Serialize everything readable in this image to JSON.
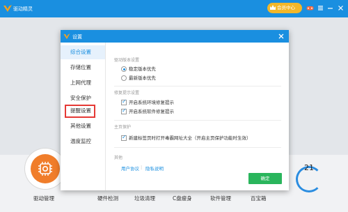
{
  "app": {
    "title": "驱动精灵",
    "vip_label": "会员中心"
  },
  "bottom_nav": [
    "驱动管理",
    "硬件检测",
    "垃圾清理",
    "C盘瘦身",
    "软件管理",
    "百宝箱"
  ],
  "score": "21",
  "dialog": {
    "title": "设置",
    "nav": [
      "综合设置",
      "存储位置",
      "上网代理",
      "安全保护",
      "提醒设置",
      "其他设置",
      "温度监控"
    ],
    "active_nav": 0,
    "highlighted_nav": 4,
    "sections": {
      "driver_version": {
        "title": "驱动版本设置",
        "options": [
          "稳定版本优先",
          "最新版本优先"
        ],
        "selected": 0
      },
      "repair_prompt": {
        "title": "修复提示设置",
        "options": [
          "开启系统环境修复提示",
          "开启系统软件修复提示"
        ],
        "checked": [
          true,
          true
        ]
      },
      "homepage": {
        "title": "主页保护",
        "option": "新建标签页时打开毒霸网址大全（开启主页保护功能时生效）",
        "checked": true
      },
      "other": {
        "title": "其他",
        "links": [
          "用户协议",
          "隐私说明"
        ],
        "separator": "|"
      }
    },
    "ok_label": "确定"
  },
  "colors": {
    "brand": "#1a8fe0",
    "ok": "#2ab55c",
    "vip": "#f2b72a",
    "highlight": "#e53935"
  }
}
